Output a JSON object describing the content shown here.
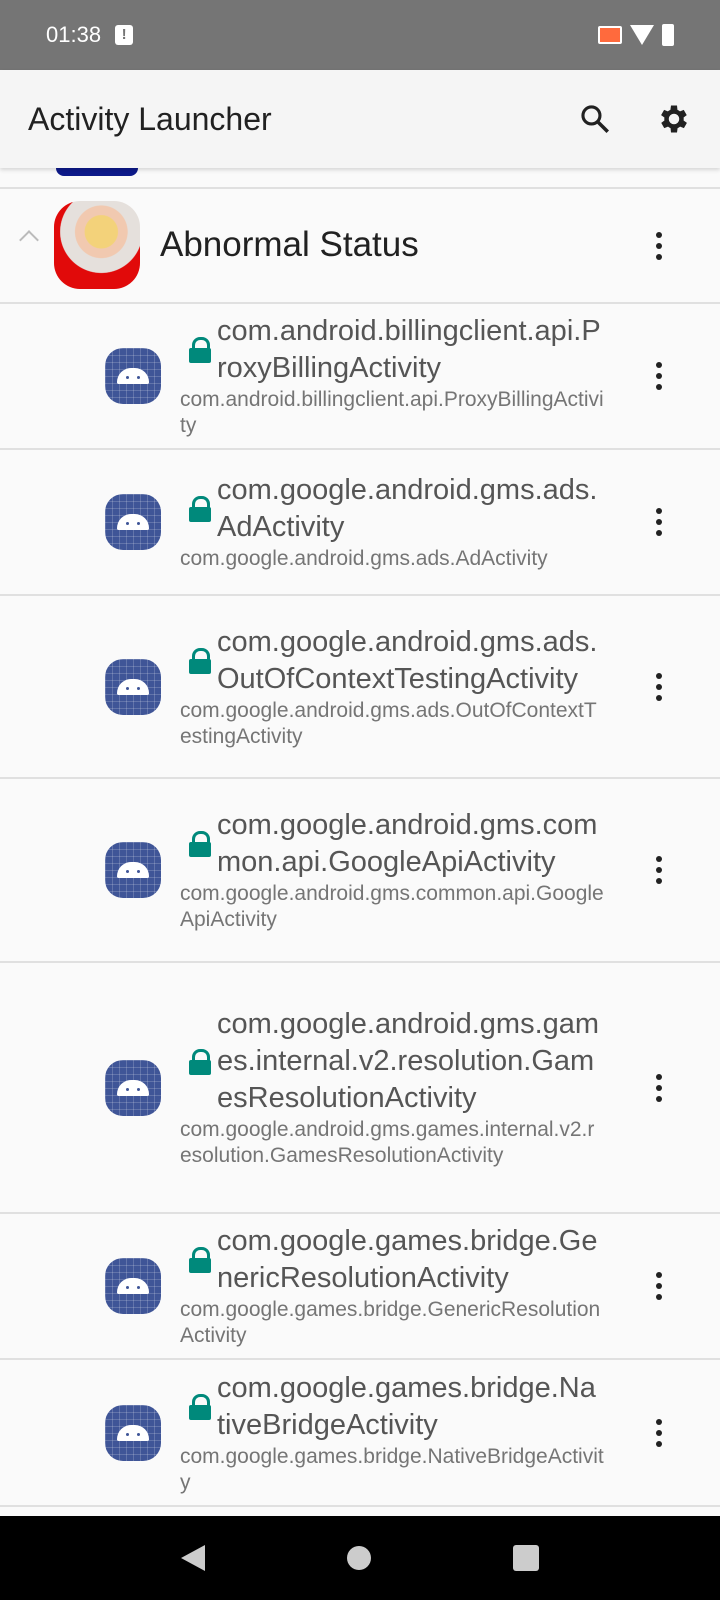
{
  "status_bar": {
    "time": "01:38",
    "icons": [
      "alert-icon",
      "cast-icon",
      "wifi-icon",
      "battery-icon"
    ]
  },
  "app_bar": {
    "title": "Activity Launcher",
    "icons": [
      "search-icon",
      "gear-icon"
    ]
  },
  "group": {
    "title": "Abnormal Status",
    "expanded": true
  },
  "activities": [
    {
      "title": "com.android.billingclient.api.ProxyBillingActivity",
      "sub": "com.android.billingclient.api.ProxyBillingActivity"
    },
    {
      "title": "com.google.android.gms.ads.AdActivity",
      "sub": "com.google.android.gms.ads.AdActivity"
    },
    {
      "title": "com.google.android.gms.ads.OutOfContextTestingActivity",
      "sub": "com.google.android.gms.ads.OutOfContextTestingActivity"
    },
    {
      "title": "com.google.android.gms.common.api.GoogleApiActivity",
      "sub": "com.google.android.gms.common.api.GoogleApiActivity"
    },
    {
      "title": "com.google.android.gms.games.internal.v2.resolution.GamesResolutionActivity",
      "sub": "com.google.android.gms.games.internal.v2.resolution.GamesResolutionActivity"
    },
    {
      "title": "com.google.games.bridge.GenericResolutionActivity",
      "sub": "com.google.games.bridge.GenericResolutionActivity"
    },
    {
      "title": "com.google.games.bridge.NativeBridgeActivity",
      "sub": "com.google.games.bridge.NativeBridgeActivity"
    }
  ],
  "colors": {
    "lock": "#00897b",
    "status_bar": "#757575",
    "app_icon": "#3f5597"
  }
}
